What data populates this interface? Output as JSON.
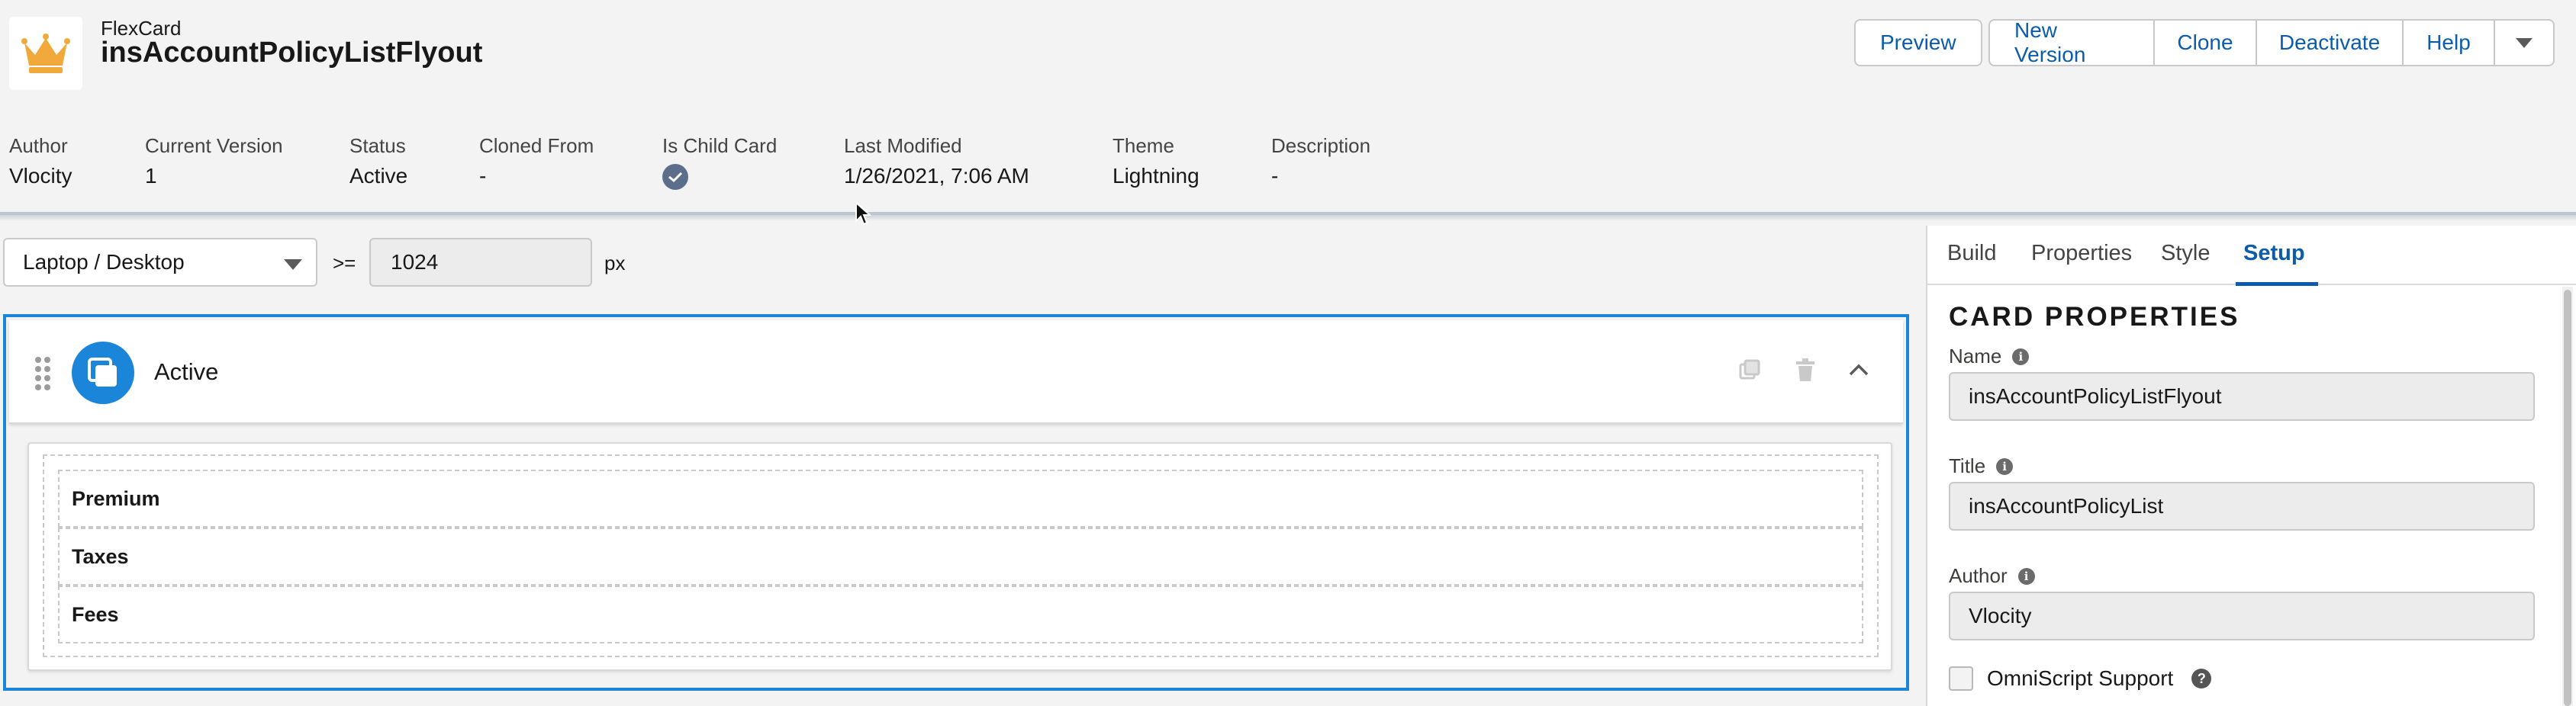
{
  "header": {
    "app_type": "FlexCard",
    "app_name": "insAccountPolicyListFlyout",
    "buttons": {
      "preview": "Preview",
      "new_version": "New Version",
      "clone": "Clone",
      "deactivate": "Deactivate",
      "help": "Help"
    },
    "meta": {
      "author_label": "Author",
      "author_value": "Vlocity",
      "version_label": "Current Version",
      "version_value": "1",
      "status_label": "Status",
      "status_value": "Active",
      "cloned_label": "Cloned From",
      "cloned_value": "-",
      "child_label": "Is Child Card",
      "modified_label": "Last Modified",
      "modified_value": "1/26/2021, 7:06 AM",
      "theme_label": "Theme",
      "theme_value": "Lightning",
      "description_label": "Description",
      "description_value": "-"
    }
  },
  "canvas": {
    "device": "Laptop / Desktop",
    "operator": ">=",
    "breakpoint": "1024",
    "unit": "px",
    "state": {
      "title": "Active",
      "fields": [
        "Premium",
        "Taxes",
        "Fees"
      ]
    }
  },
  "panel": {
    "tabs": [
      "Build",
      "Properties",
      "Style",
      "Setup"
    ],
    "active_tab": "Setup",
    "section_title": "CARD PROPERTIES",
    "name_label": "Name",
    "name_value": "insAccountPolicyListFlyout",
    "title_label": "Title",
    "title_value": "insAccountPolicyList",
    "author_label": "Author",
    "author_value": "Vlocity",
    "omniscript_label": "OmniScript Support"
  },
  "colors": {
    "accent": "#0b5cab",
    "selection_border": "#1b86d9",
    "brand_icon": "#f2a93b"
  }
}
